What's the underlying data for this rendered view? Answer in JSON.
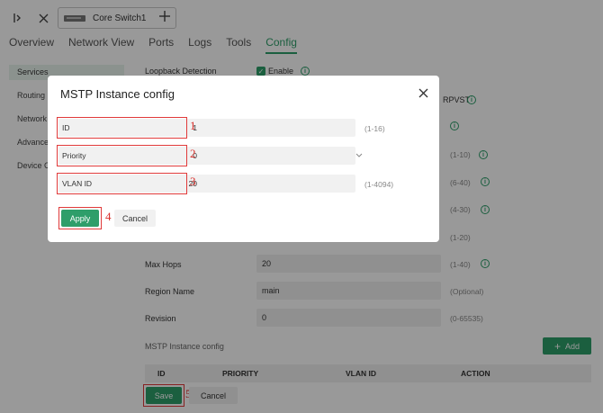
{
  "toolbar": {
    "device_tab_label": "Core Switch1",
    "icons": [
      "sidebar-toggle-icon",
      "close-icon",
      "device-icon",
      "plus-icon"
    ]
  },
  "nav": {
    "tabs": [
      "Overview",
      "Network View",
      "Ports",
      "Logs",
      "Tools",
      "Config"
    ],
    "active": "Config"
  },
  "sidebar": {
    "items": [
      {
        "label": "Services",
        "active": true
      },
      {
        "label": "Routing"
      },
      {
        "label": "Network"
      },
      {
        "label": "Advance"
      },
      {
        "label": "Device C"
      }
    ]
  },
  "form": {
    "loopback": {
      "label": "Loopback Detection",
      "checkbox_label": "Enable",
      "checked": true
    },
    "rpvst_label": "RPVST",
    "hidden_hints": [
      "(1-10)",
      "(6-40)",
      "(4-30)",
      "(1-20)"
    ],
    "max_hops": {
      "label": "Max Hops",
      "value": "20",
      "hint": "(1-40)"
    },
    "region_name": {
      "label": "Region Name",
      "value": "main",
      "hint": "(Optional)"
    },
    "revision": {
      "label": "Revision",
      "value": "0",
      "hint": "(0-65535)"
    },
    "section_title": "MSTP Instance config",
    "add_label": "Add",
    "table_headers": [
      "ID",
      "PRIORITY",
      "VLAN ID",
      "ACTION"
    ],
    "save_label": "Save",
    "cancel_label": "Cancel"
  },
  "modal": {
    "title": "MSTP Instance config",
    "fields": [
      {
        "label": "ID",
        "value": "1",
        "hint": "(1-16)"
      },
      {
        "label": "Priority",
        "value": "0",
        "hint": ""
      },
      {
        "label": "VLAN ID",
        "value": "20",
        "hint": "(1-4094)"
      }
    ],
    "apply_label": "Apply",
    "cancel_label": "Cancel"
  },
  "steps": [
    "1",
    "2",
    "3",
    "4",
    "5"
  ],
  "colors": {
    "accent": "#2e9e6a",
    "annotation": "#e03a3a"
  }
}
